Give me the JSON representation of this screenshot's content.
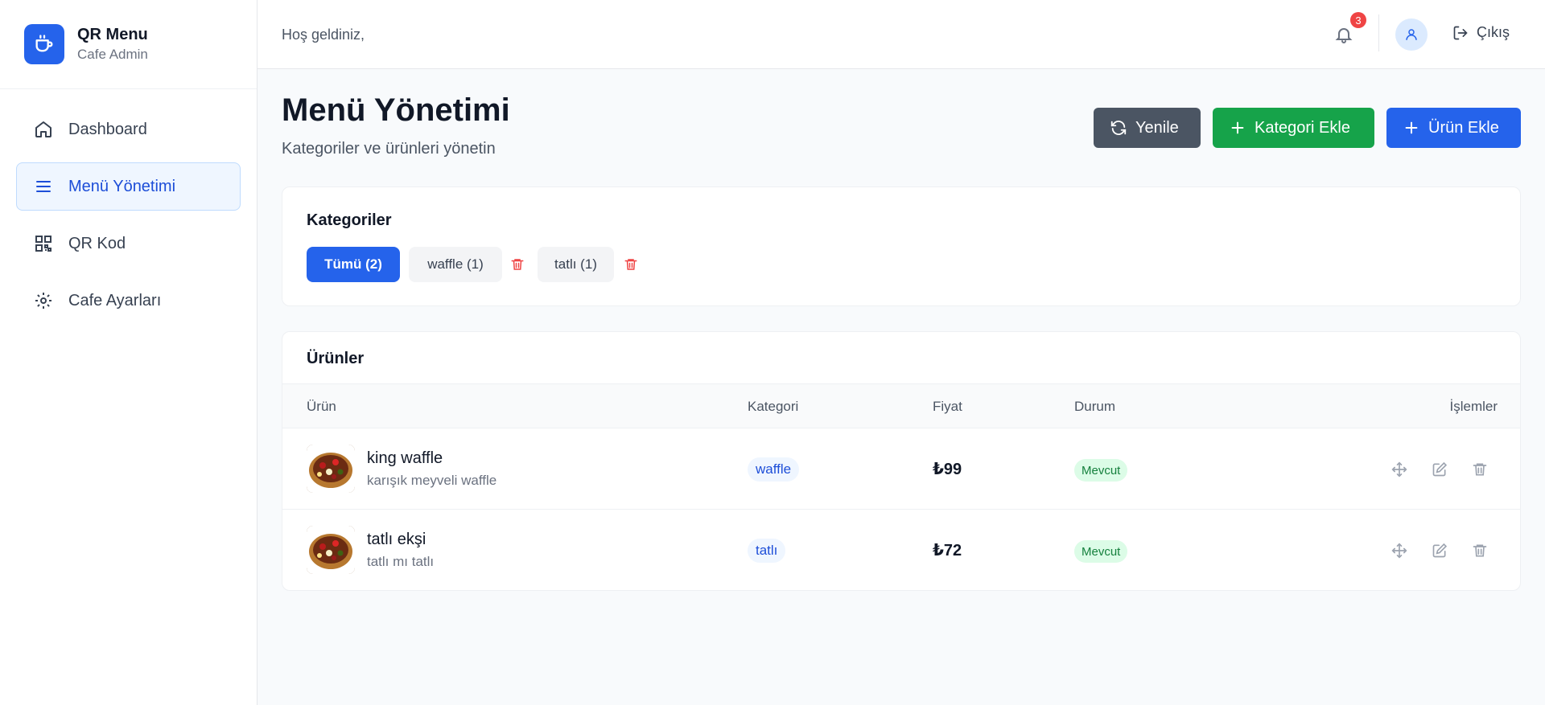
{
  "brand": {
    "title": "QR Menu",
    "subtitle": "Cafe Admin",
    "icon": "coffee-cup-icon"
  },
  "sidebar": {
    "items": [
      {
        "label": "Dashboard",
        "icon": "home-icon",
        "active": false
      },
      {
        "label": "Menü Yönetimi",
        "icon": "menu-lines-icon",
        "active": true
      },
      {
        "label": "QR Kod",
        "icon": "qr-code-icon",
        "active": false
      },
      {
        "label": "Cafe Ayarları",
        "icon": "gear-icon",
        "active": false
      }
    ]
  },
  "header": {
    "welcome": "Hoş geldiniz,",
    "notification_count": "3",
    "logout_label": "Çıkış"
  },
  "main": {
    "title": "Menü Yönetimi",
    "subtitle": "Kategoriler ve ürünleri yönetin",
    "buttons": {
      "refresh": "Yenile",
      "add_category": "Kategori Ekle",
      "add_product": "Ürün Ekle"
    },
    "categories": {
      "title": "Kategoriler",
      "chips": [
        {
          "label": "Tümü (2)",
          "selected": true
        },
        {
          "label": "waffle (1)",
          "selected": false
        },
        {
          "label": "tatlı (1)",
          "selected": false
        }
      ]
    },
    "products": {
      "title": "Ürünler",
      "columns": [
        "Ürün",
        "Kategori",
        "Fiyat",
        "Durum",
        "İşlemler"
      ],
      "rows": [
        {
          "name": "king waffle",
          "description": "karışık meyveli waffle",
          "category": "waffle",
          "price": "₺99",
          "status": "Mevcut"
        },
        {
          "name": "tatlı ekşi",
          "description": "tatlı mı tatlı",
          "category": "tatlı",
          "price": "₺72",
          "status": "Mevcut"
        }
      ]
    }
  },
  "colors": {
    "primary": "#2563eb",
    "success": "#16a34a",
    "neutral_button": "#4b5563",
    "danger": "#ef4444"
  }
}
